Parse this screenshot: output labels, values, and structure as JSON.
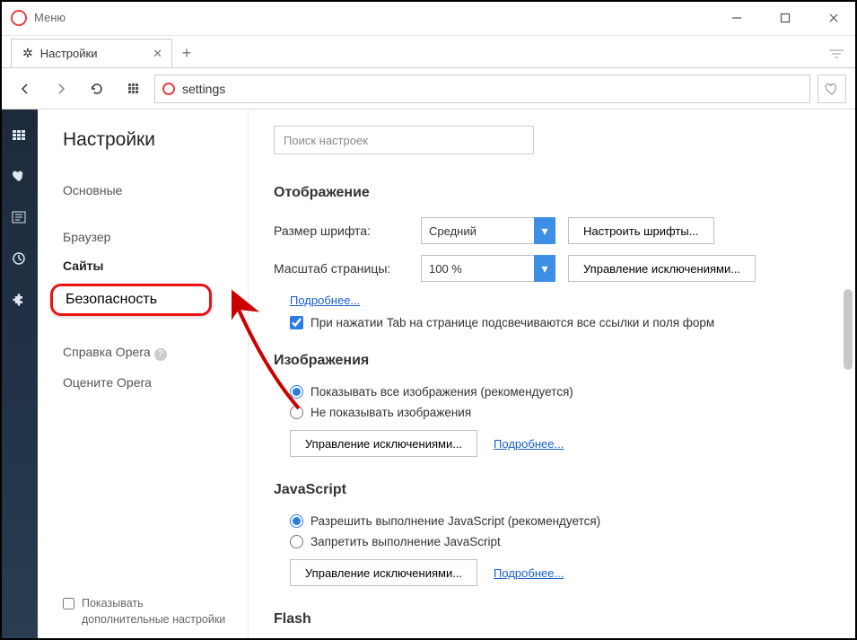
{
  "titlebar": {
    "menu_label": "Меню"
  },
  "tab": {
    "title": "Настройки"
  },
  "addressbar": {
    "url": "settings"
  },
  "sidebar": {
    "heading": "Настройки",
    "items": [
      "Основные",
      "Браузер",
      "Сайты",
      "Безопасность",
      "Справка Opera",
      "Оцените Opera"
    ],
    "advanced_label": "Показывать дополнительные настройки"
  },
  "main": {
    "search_placeholder": "Поиск настроек",
    "display": {
      "title": "Отображение",
      "font_label": "Размер шрифта:",
      "font_value": "Средний",
      "font_btn": "Настроить шрифты...",
      "zoom_label": "Масштаб страницы:",
      "zoom_value": "100 %",
      "zoom_btn": "Управление исключениями...",
      "more": "Подробнее...",
      "tab_check": "При нажатии Tab на странице подсвечиваются все ссылки и поля форм"
    },
    "images": {
      "title": "Изображения",
      "opt1": "Показывать все изображения (рекомендуется)",
      "opt2": "Не показывать изображения",
      "exceptions": "Управление исключениями...",
      "more": "Подробнее..."
    },
    "js": {
      "title": "JavaScript",
      "opt1": "Разрешить выполнение JavaScript (рекомендуется)",
      "opt2": "Запретить выполнение JavaScript",
      "exceptions": "Управление исключениями...",
      "more": "Подробнее..."
    },
    "flash_title": "Flash"
  }
}
